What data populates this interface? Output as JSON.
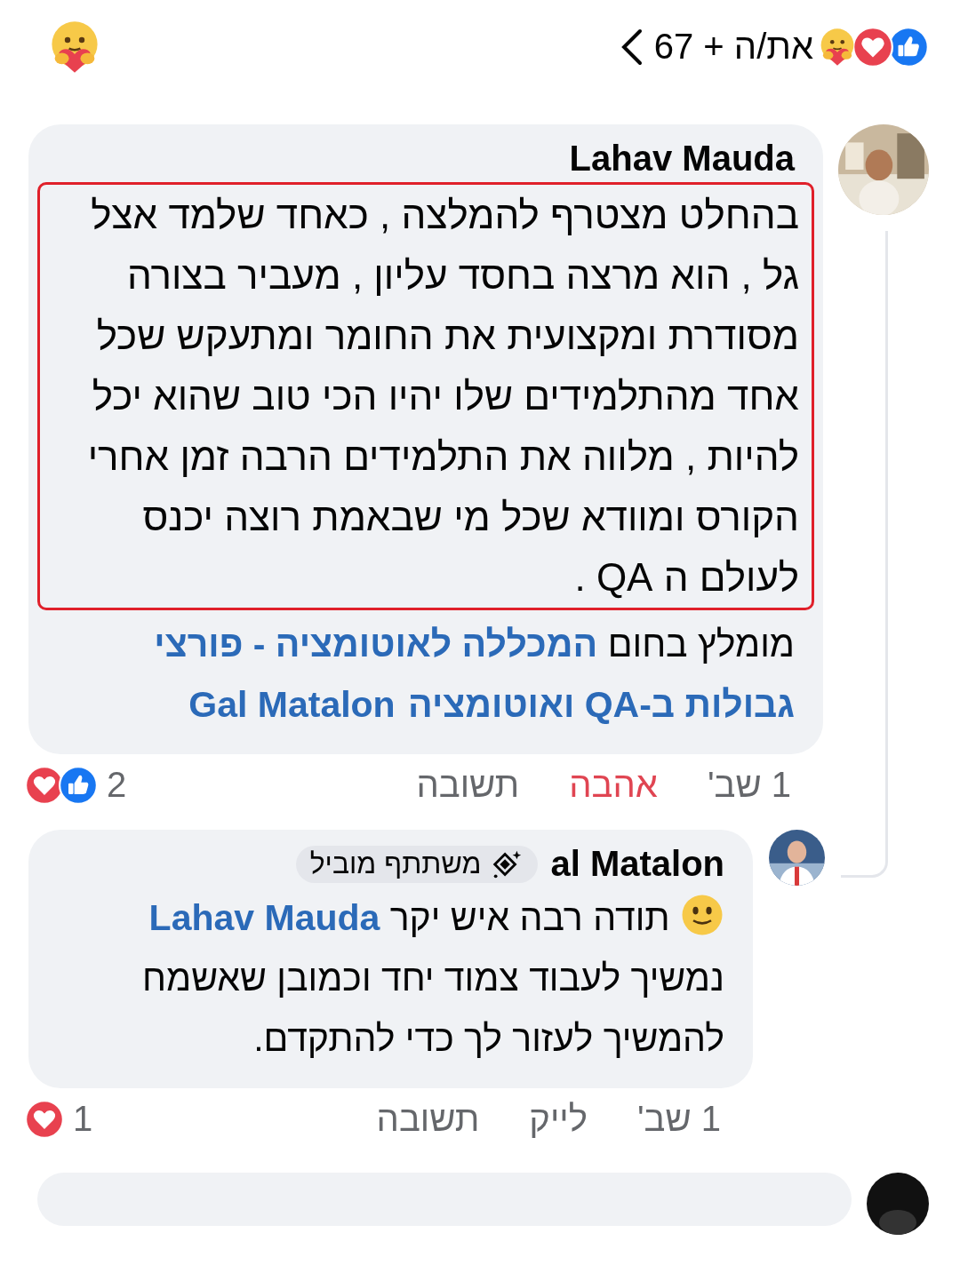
{
  "header": {
    "reactions": [
      {
        "kind": "like"
      },
      {
        "kind": "love"
      },
      {
        "kind": "care"
      }
    ],
    "summary": "את/ה + 67"
  },
  "comments": [
    {
      "author": "Lahav Mauda",
      "body": "בהחלט מצטרף להמלצה , כאחד שלמד אצל גל , הוא מרצה בחסד עליון , מעביר בצורה מסודרת ומקצועית את החומר ומתעקש שכל אחד מהתלמידים שלו יהיו הכי טוב שהוא יכל להיות , מלווה את התלמידים הרבה זמן אחרי הקורס ומוודא שכל מי שבאמת רוצה יכנס לעולם ה QA .",
      "highlighted": true,
      "segments": [
        {
          "kind": "text",
          "text": "מומלץ בחום "
        },
        {
          "kind": "link",
          "text": "המכללה לאוטומציה - פורצי גבולות ב-QA ואוטומציה"
        },
        {
          "kind": "link",
          "text": "Gal Matalon"
        }
      ],
      "actions": {
        "time": "1 שב'",
        "react": {
          "text": "אהבה",
          "reacted": true
        },
        "reply": "תשובה"
      },
      "reactions": {
        "icons": [
          {
            "kind": "love"
          },
          {
            "kind": "like"
          }
        ],
        "count": "2"
      },
      "replies": [
        {
          "author": "al Matalon",
          "badge": "משתתף מוביל",
          "highlighted": false,
          "segments": [
            {
              "kind": "emoji"
            },
            {
              "kind": "text",
              "text": " תודה רבה איש יקר "
            },
            {
              "kind": "link",
              "text": "Lahav Mauda"
            },
            {
              "kind": "text",
              "text": " נמשיך לעבוד צמוד יחד וכמובן שאשמח להמשיך לעזור לך כדי להתקדם."
            }
          ],
          "actions": {
            "time": "1 שב'",
            "react": {
              "text": "לייק",
              "reacted": false
            },
            "reply": "תשובה"
          },
          "reactions": {
            "icons": [
              {
                "kind": "love"
              }
            ],
            "count": "1"
          }
        }
      ]
    }
  ]
}
